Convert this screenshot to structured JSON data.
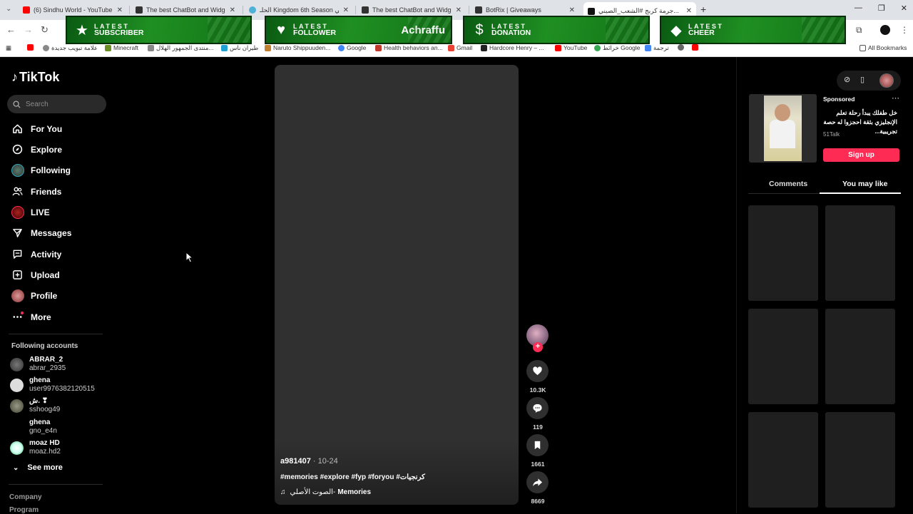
{
  "browser": {
    "tabs": [
      {
        "label": "(6) Sindhu World - YouTube",
        "color": "#ff0000"
      },
      {
        "label": "The best ChatBot and Widgets",
        "color": "#333333"
      },
      {
        "label": "الحلـ Kingdom 6th Season انمي",
        "color": "#4fb0d8"
      },
      {
        "label": "The best ChatBot and Widgets",
        "color": "#333333"
      },
      {
        "label": "BotRix | Giveaways",
        "color": "#333333"
      },
      {
        "label": "جرمة كربج #الشعب_الصيني...",
        "color": "#111111"
      }
    ],
    "new_tab": "+",
    "bookmarks": [
      {
        "label": "",
        "color": "#ff0000"
      },
      {
        "label": "علامة تبويب جديدة",
        "color": "#888888"
      },
      {
        "label": "Minecraft",
        "color": "#6b8e23"
      },
      {
        "label": "منتدى الجمهور الهلال...",
        "color": "#888888"
      },
      {
        "label": "طيران ناس",
        "color": "#21a0d2"
      },
      {
        "label": "Naruto Shippuuden...",
        "color": "#c08030"
      },
      {
        "label": "Google",
        "color": "#4285f4"
      },
      {
        "label": "Health behaviors an...",
        "color": "#c0392b"
      },
      {
        "label": "Gmail",
        "color": "#ea4335"
      },
      {
        "label": "Hardcore Henry – ...",
        "color": "#222222"
      },
      {
        "label": "YouTube",
        "color": "#ff0000"
      },
      {
        "label": "خرائط Google",
        "color": "#34a853"
      },
      {
        "label": "ترجمة",
        "color": "#4285f4"
      }
    ],
    "all_bookmarks": "All Bookmarks"
  },
  "alerts": [
    {
      "line1": "LATEST",
      "line2": "SUBSCRIBER",
      "name": "",
      "icon": "★"
    },
    {
      "line1": "LATEST",
      "line2": "FOLLOWER",
      "name": "Achraffu",
      "icon": "♥"
    },
    {
      "line1": "LATEST",
      "line2": "DONATION",
      "name": "",
      "icon": "$"
    },
    {
      "line1": "LATEST",
      "line2": "CHEER",
      "name": "",
      "icon": "◆"
    }
  ],
  "sidebar": {
    "logo": "TikTok",
    "search_placeholder": "Search",
    "nav": [
      {
        "label": "For You",
        "icon": "home-icon"
      },
      {
        "label": "Explore",
        "icon": "compass-icon"
      },
      {
        "label": "Following",
        "icon": "following-avatar"
      },
      {
        "label": "Friends",
        "icon": "friends-icon"
      },
      {
        "label": "LIVE",
        "icon": "live-icon"
      },
      {
        "label": "Messages",
        "icon": "messages-icon"
      },
      {
        "label": "Activity",
        "icon": "activity-icon"
      },
      {
        "label": "Upload",
        "icon": "upload-icon"
      },
      {
        "label": "Profile",
        "icon": "profile-avatar"
      },
      {
        "label": "More",
        "icon": "more-icon"
      }
    ],
    "following_title": "Following accounts",
    "accounts": [
      {
        "name": "ABRAR_2",
        "handle": "abrar_2935"
      },
      {
        "name": "ghena",
        "handle": "user9976382120515"
      },
      {
        "name": "ش. ❣",
        "handle": "sshoog49"
      },
      {
        "name": "ghena",
        "handle": "gno_e4n"
      },
      {
        "name": "moaz HD",
        "handle": "moaz.hd2"
      }
    ],
    "see_more": "See more",
    "footer": [
      "Company",
      "Program"
    ]
  },
  "video": {
    "author": "a981407",
    "date": " · 10-24",
    "tags": "#memories #explore #fyp #foryou #كرنجيات",
    "music_original": "الصوت الأصلي",
    "music_sep": " - ",
    "music_title": "Memories",
    "actions": {
      "likes": "10.3K",
      "comments": "119",
      "saves": "1661",
      "shares": "8669"
    }
  },
  "right_panel": {
    "sponsored": "Sponsored",
    "ad_text": "خل طفلك يبدأ رحلة تعلم الإنجليزي بثقة احجزوا له حصة تجريبية...",
    "ad_brand": "51Talk",
    "signup": "Sign up",
    "tabs": [
      "Comments",
      "You may like"
    ],
    "active_tab": "You may like"
  }
}
